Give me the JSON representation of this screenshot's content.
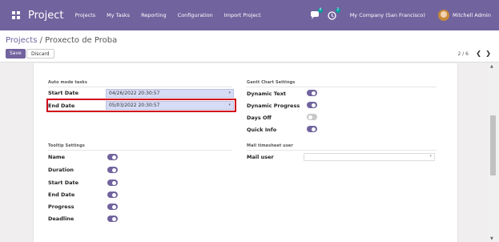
{
  "navbar": {
    "brand": "Project",
    "menu": [
      "Projects",
      "My Tasks",
      "Reporting",
      "Configuration",
      "Import Project"
    ],
    "messages_badge": "4",
    "activity_badge": "2",
    "company": "My Company (San Francisco)",
    "user": "Mitchell Admin",
    "color": "#71639e"
  },
  "breadcrumb": {
    "parent": "Projects",
    "separator": " / ",
    "current": "Proxecto de Proba"
  },
  "buttons": {
    "save": "Save",
    "discard": "Discard"
  },
  "pager": {
    "value": "2 / 6",
    "prev_icon": "chevron-left-icon",
    "next_icon": "chevron-right-icon"
  },
  "auto_mode": {
    "title": "Auto mode tasks",
    "start_label": "Start Date",
    "start_value": "04/26/2022 20:30:57",
    "end_label": "End Date",
    "end_value": "05/03/2022 20:30:57"
  },
  "gantt": {
    "title": "Gantt Chart Settings",
    "items": [
      {
        "label": "Dynamic Text",
        "on": true
      },
      {
        "label": "Dynamic Progress",
        "on": true
      },
      {
        "label": "Days Off",
        "on": false
      },
      {
        "label": "Quick Info",
        "on": true
      }
    ]
  },
  "tooltip": {
    "title": "Tooltip Settings",
    "items": [
      {
        "label": "Name",
        "on": true
      },
      {
        "label": "Duration",
        "on": true
      },
      {
        "label": "Start Date",
        "on": true
      },
      {
        "label": "End Date",
        "on": true
      },
      {
        "label": "Progress",
        "on": true
      },
      {
        "label": "Deadline",
        "on": true
      }
    ]
  },
  "mail": {
    "title": "Mail timesheet user",
    "label": "Mail user",
    "value": ""
  }
}
